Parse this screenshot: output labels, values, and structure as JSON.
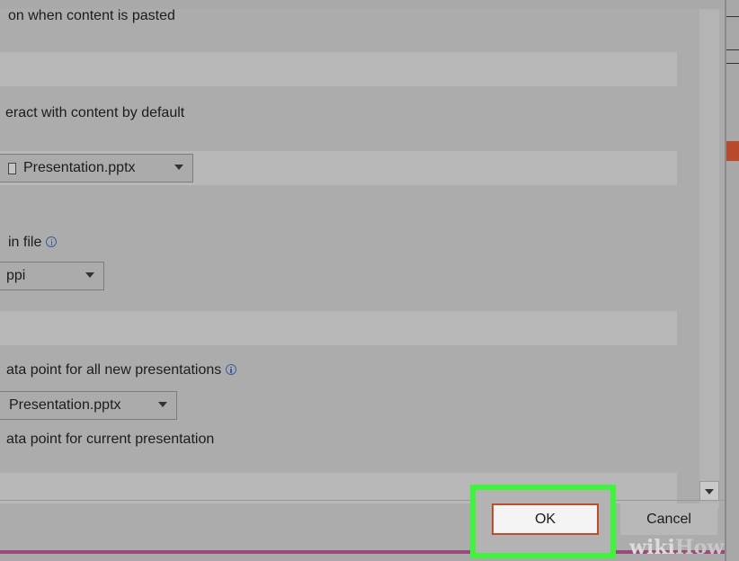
{
  "dialog": {
    "rows": {
      "paste_option": "on when content is pasted",
      "interact_default": "eract with content by default",
      "file_selector_1": "Presentation.pptx",
      "image_size_label": "in file",
      "resolution_value": "ppi",
      "data_point_all": "ata point for all new presentations",
      "file_selector_2": "Presentation.pptx",
      "data_point_current": "ata point for current presentation"
    }
  },
  "buttons": {
    "ok": "OK",
    "cancel": "Cancel"
  },
  "watermark": {
    "part1": "wiki",
    "part2": "How"
  },
  "colors": {
    "highlight": "#3ff53b",
    "ok_border": "#c14b2a",
    "info_icon": "#3b5d9c"
  }
}
